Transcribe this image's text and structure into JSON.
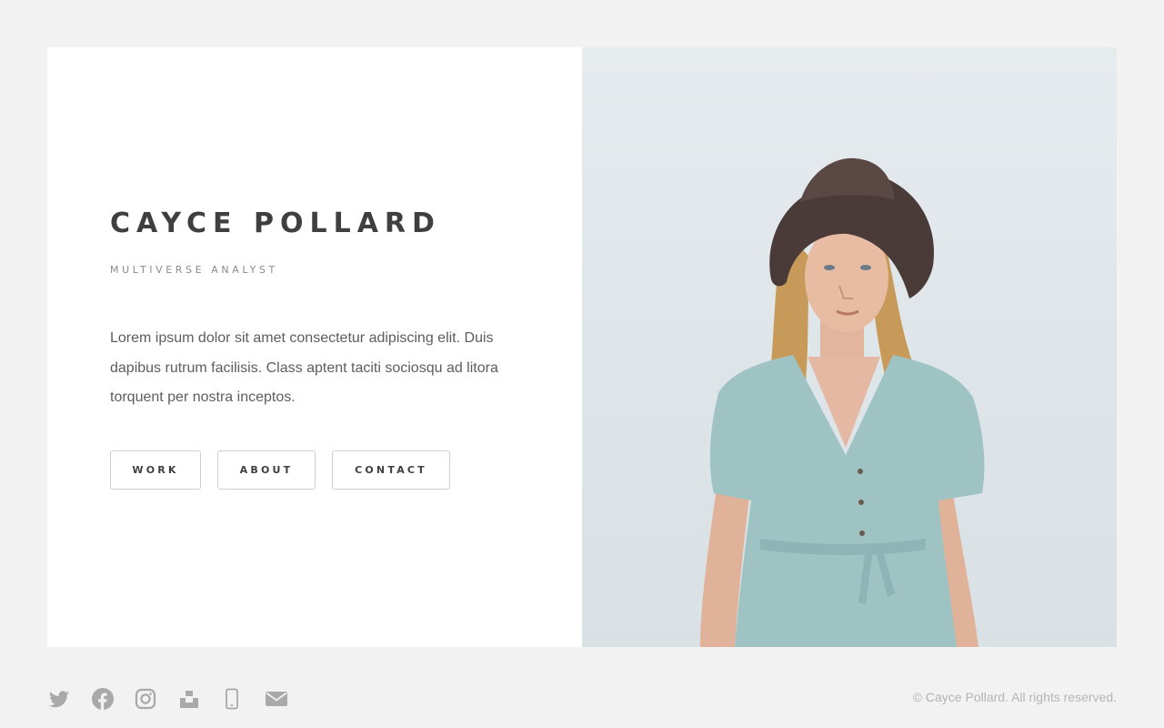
{
  "profile": {
    "name": "CAYCE POLLARD",
    "role": "MULTIVERSE ANALYST",
    "bio": "Lorem ipsum dolor sit amet consectetur adipiscing elit. Duis dapibus rutrum facilisis. Class aptent taciti sociosqu ad litora torquent per nostra inceptos."
  },
  "nav": {
    "work": "WORK",
    "about": "ABOUT",
    "contact": "CONTACT"
  },
  "social_icons": [
    "twitter-icon",
    "facebook-icon",
    "instagram-icon",
    "unsplash-icon",
    "phone-icon",
    "email-icon"
  ],
  "footer": {
    "copyright": "© Cayce Pollard. All rights reserved."
  },
  "colors": {
    "background": "#f2f2f2",
    "card": "#ffffff",
    "heading": "#3f3f3f",
    "icon": "#a9a9a9",
    "dress": "#9fc2c3",
    "hat": "#4a3b39"
  }
}
